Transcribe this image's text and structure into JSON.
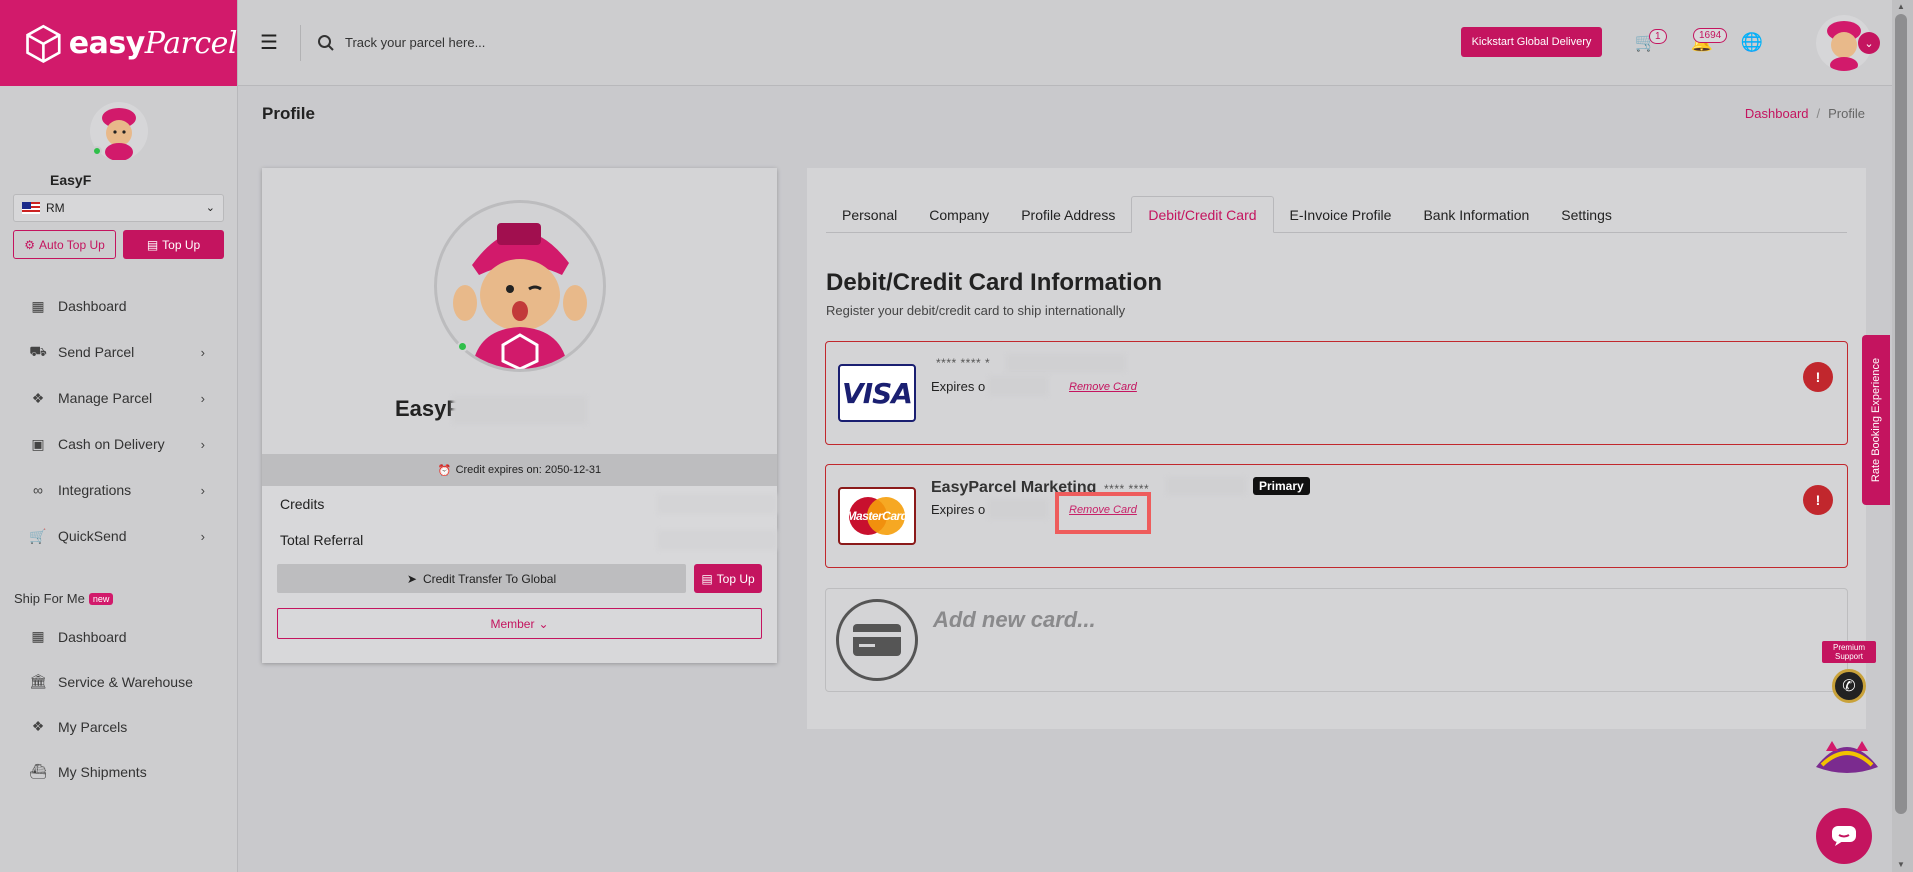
{
  "brand": {
    "logo_text_1": "easy",
    "logo_text_2": "Parcel"
  },
  "sidebar": {
    "user_name": "EasyF",
    "wallet_value": "RM",
    "auto_topup_label": "Auto Top Up",
    "topup_label": "Top Up",
    "nav": [
      {
        "label": "Dashboard",
        "icon": "dashboard-icon",
        "has_arrow": false
      },
      {
        "label": "Send Parcel",
        "icon": "truck-icon",
        "has_arrow": true
      },
      {
        "label": "Manage Parcel",
        "icon": "boxes-icon",
        "has_arrow": true
      },
      {
        "label": "Cash on Delivery",
        "icon": "cash-icon",
        "has_arrow": true
      },
      {
        "label": "Integrations",
        "icon": "link-icon",
        "has_arrow": true
      },
      {
        "label": "QuickSend",
        "icon": "cart-icon",
        "has_arrow": true
      }
    ],
    "ship_for_me": {
      "title": "Ship For Me",
      "badge": "new",
      "items": [
        {
          "label": "Dashboard",
          "icon": "dashboard-icon"
        },
        {
          "label": "Service & Warehouse",
          "icon": "bank-icon"
        },
        {
          "label": "My Parcels",
          "icon": "boxes-icon"
        },
        {
          "label": "My Shipments",
          "icon": "ship-icon"
        }
      ]
    }
  },
  "topbar": {
    "search_placeholder": "Track your parcel here...",
    "kickstart_label": "Kickstart Global Delivery",
    "cart_count": "1",
    "notif_count": "1694"
  },
  "page": {
    "title": "Profile",
    "breadcrumb": [
      "Dashboard",
      "Profile"
    ]
  },
  "profile_card": {
    "name": "EasyF",
    "credit_expires": "Credit expires on: 2050-12-31",
    "credits_label": "Credits",
    "referral_label": "Total Referral",
    "transfer_label": "Credit Transfer To Global",
    "topup_label": "Top Up",
    "member_label": "Member"
  },
  "tabs": [
    "Personal",
    "Company",
    "Profile Address",
    "Debit/Credit Card",
    "E-Invoice Profile",
    "Bank Information",
    "Settings"
  ],
  "active_tab": "Debit/Credit Card",
  "cards_section": {
    "title": "Debit/Credit Card Information",
    "subtitle": "Register your debit/credit card to ship internationally",
    "cards": [
      {
        "brand": "VISA",
        "number": "**** **** *",
        "expires": "Expires o",
        "remove_label": "Remove Card"
      },
      {
        "brand": "MasterCard",
        "holder": "EasyParcel Marketing",
        "number": "**** ****",
        "expires": "Expires o",
        "remove_label": "Remove Card",
        "primary_label": "Primary"
      }
    ],
    "add_new_label": "Add new card..."
  },
  "floating": {
    "rate_tab": "Rate Booking Experience",
    "premium_support": "Premium Support"
  },
  "colors": {
    "brand": "#d21a6b",
    "accent": "#c4145f",
    "danger": "#c1272d"
  }
}
